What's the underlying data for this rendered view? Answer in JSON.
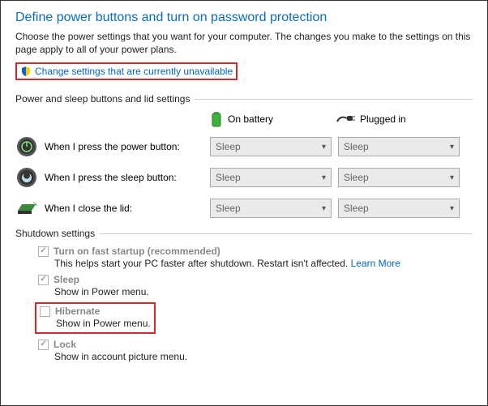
{
  "title": "Define power buttons and turn on password protection",
  "description": "Choose the power settings that you want for your computer. The changes you make to the settings on this page apply to all of your power plans.",
  "change_link": "Change settings that are currently unavailable",
  "group1": "Power and sleep buttons and lid settings",
  "columns": {
    "battery": "On battery",
    "plugged": "Plugged in"
  },
  "rows": {
    "power": {
      "label": "When I press the power button:",
      "battery": "Sleep",
      "plugged": "Sleep"
    },
    "sleep": {
      "label": "When I press the sleep button:",
      "battery": "Sleep",
      "plugged": "Sleep"
    },
    "lid": {
      "label": "When I close the lid:",
      "battery": "Sleep",
      "plugged": "Sleep"
    }
  },
  "group2": "Shutdown settings",
  "shutdown": {
    "faststartup": {
      "title": "Turn on fast startup (recommended)",
      "sub": "This helps start your PC faster after shutdown. Restart isn't affected. ",
      "learn": "Learn More"
    },
    "sleep": {
      "title": "Sleep",
      "sub": "Show in Power menu."
    },
    "hibernate": {
      "title": "Hibernate",
      "sub": "Show in Power menu."
    },
    "lock": {
      "title": "Lock",
      "sub": "Show in account picture menu."
    }
  }
}
